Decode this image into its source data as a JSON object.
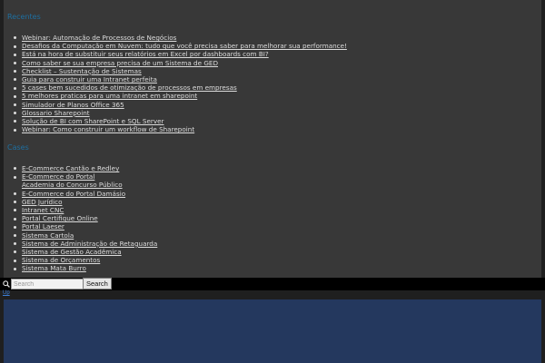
{
  "sections": [
    {
      "title": "Recentes",
      "items": [
        "Webinar: Automação de Processos de Negócios",
        "Desafios da Computação em Nuvem: tudo que você precisa saber para melhorar sua performance!",
        "Está na hora de substituir seus relatórios em Excel por dashboards com BI?",
        "Como saber se sua empresa precisa de um Sistema de GED",
        "Checklist – Sustentação de Sistemas",
        "Guia para construir uma Intranet perfeita",
        "5 cases bem sucedidos de otimização de processos em empresas",
        "5 melhores praticas para uma intranet em sharepoint",
        "Simulador de Planos Office 365",
        "Glossario Sharepoint",
        "Solução de BI com SharePoint e SQL Server",
        "Webinar: Como construir um workflow de Sharepoint"
      ]
    },
    {
      "title": "Cases",
      "items": [
        "E-Commerce Cantão e Redley",
        "E-Commerce do Portal|Academia do Concurso Público",
        "E-Commerce do Portal Damásio",
        "GED Jurídico",
        "Intranet CNC",
        "Portal Certifique Online",
        "Portal Laeser",
        "Sistema Cartola",
        "Sistema de Administração de Retaguarda",
        "Sistema de Gestão Acadêmica",
        "Sistema de Orçamentos",
        "Sistema Mata Burro"
      ]
    }
  ],
  "search": {
    "placeholder": "Search",
    "button_label": "Search",
    "icon": "search-icon"
  },
  "top_link": "Up",
  "colors": {
    "panel": "#383838",
    "section_title": "#1e6fa0",
    "link": "#dcdcdc",
    "footer_blue": "#24385e"
  }
}
